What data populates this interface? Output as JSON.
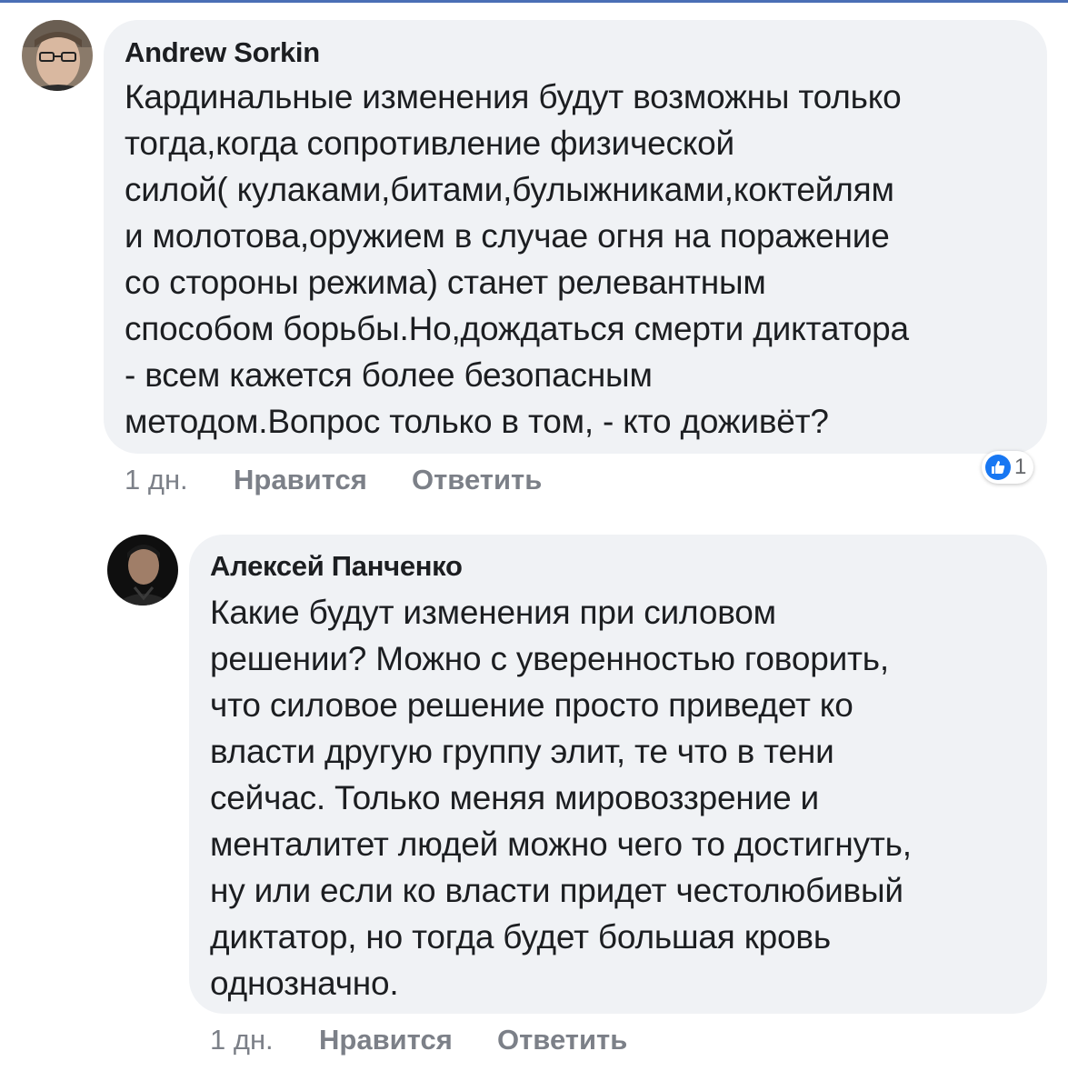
{
  "comments": [
    {
      "author": "Andrew Sorkin",
      "lines": [
        "Кардинальные изменения будут возможны только",
        "тогда,когда сопротивление физической",
        "силой( кулаками,битами,булыжниками,коктейлям",
        "и молотова,оружием в случае огня на поражение",
        "со стороны режима) станет релевантным",
        "способом борьбы.Но,дождаться смерти диктатора",
        "- всем кажется более безопасным",
        "методом.Вопрос только в том, - кто доживёт?"
      ],
      "time": "1 дн.",
      "like_label": "Нравится",
      "reply_label": "Ответить",
      "reaction_icon": "like-icon",
      "reaction_count": "1"
    },
    {
      "author": "Алексей Панченко",
      "lines": [
        "Какие будут изменения при силовом",
        "решении? Можно с уверенностью говорить,",
        "что силовое решение просто приведет ко",
        "власти другую группу элит, те что в тени",
        "сейчас. Только меняя мировоззрение и",
        "менталитет людей можно чего то достигнуть,",
        "ну или если ко власти придет честолюбивый",
        "диктатор, но тогда будет большая кровь",
        "однозначно."
      ],
      "time": "1 дн.",
      "like_label": "Нравится",
      "reply_label": "Ответить"
    }
  ],
  "colors": {
    "bubble": "#f0f2f5",
    "text": "#1c1e21",
    "meta": "#7c8088",
    "like_blue": "#1877f2",
    "top_bar": "#4a6fb5"
  }
}
